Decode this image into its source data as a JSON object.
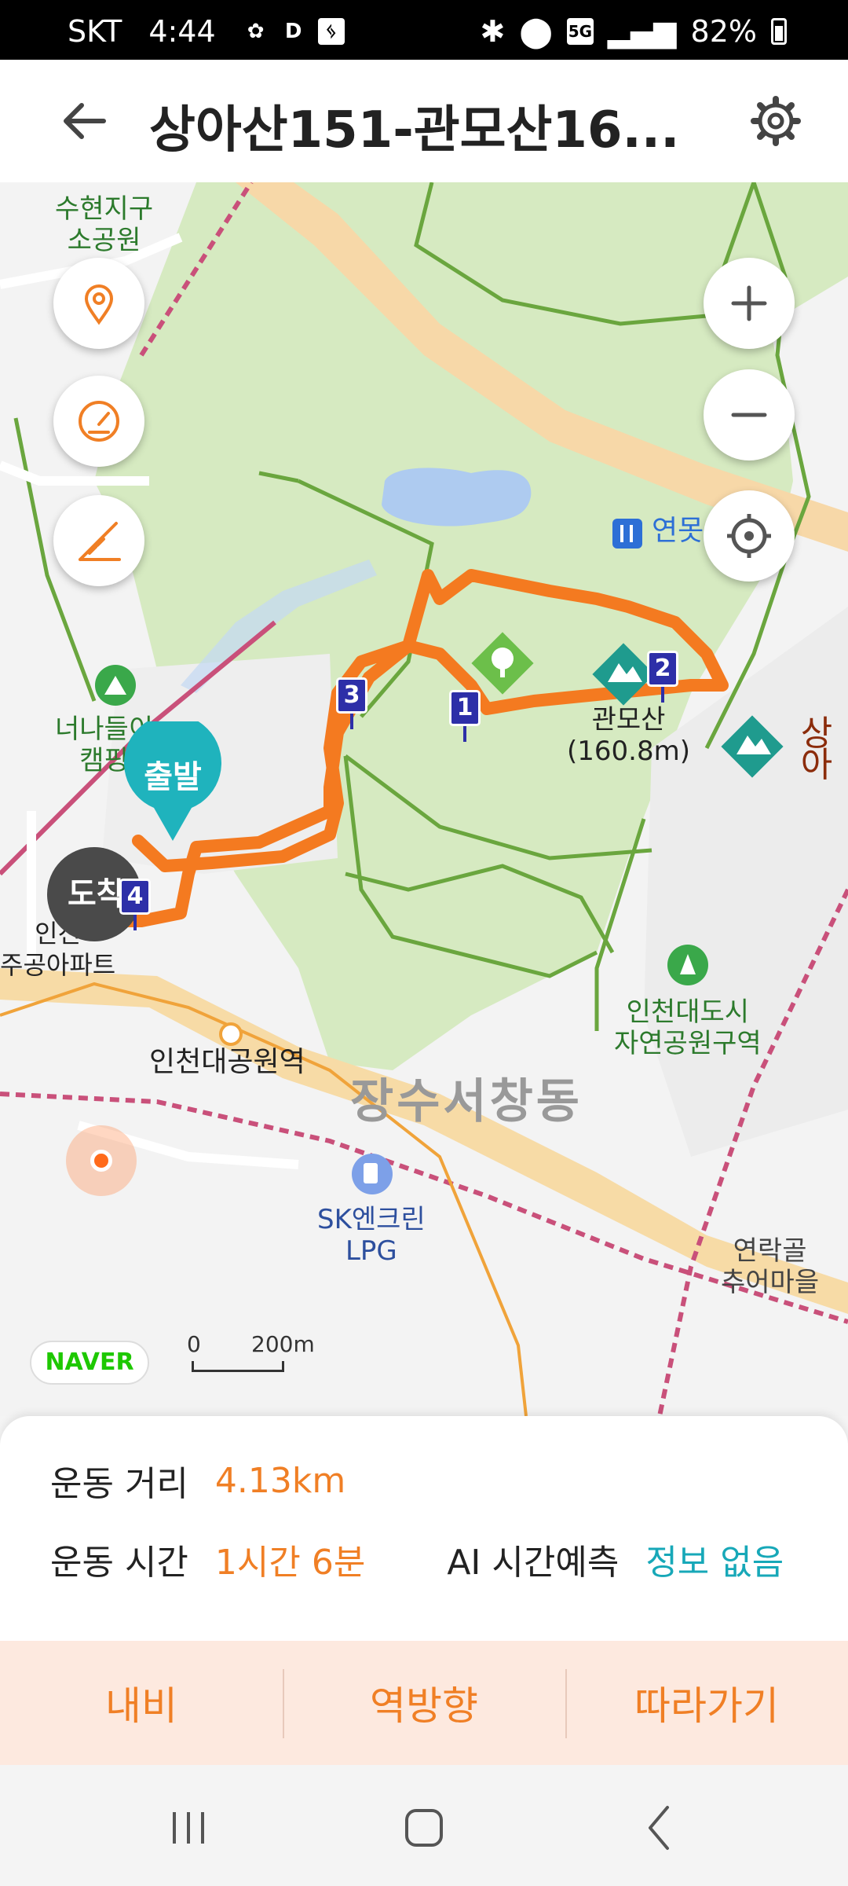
{
  "status_bar": {
    "carrier": "SKT",
    "time": "4:44",
    "network": "5G",
    "battery": "82%"
  },
  "header": {
    "title": "상아산151-관모산16..."
  },
  "map": {
    "labels": {
      "suhyeon": "수현지구\n소공원",
      "yeonmot": "연못",
      "gwanmosan": "관모산\n(160.8m)",
      "sanga": "상아",
      "naneul_camping": "너나들이\n캠핑",
      "incheon_apt": "인천\n주공아파트",
      "station": "인천대공원역",
      "district": "장수서창동",
      "nature_park": "인천대도시\n자연공원구역",
      "sk_lpg": "SK엔크린\nLPG",
      "yeonrakgol": "연락골\n추어마을"
    },
    "markers": {
      "start": "출발",
      "end": "도착",
      "waypoints": [
        "1",
        "2",
        "3",
        "4"
      ]
    },
    "naver_logo": "NAVER",
    "scale": {
      "zero": "0",
      "distance": "200m"
    },
    "colors": {
      "route": "#f47a20",
      "park": "#d8ebc4",
      "water": "#aecbf0",
      "accent": "#f07f25"
    }
  },
  "info": {
    "distance_label": "운동 거리",
    "distance_value": "4.13km",
    "time_label": "운동 시간",
    "time_value": "1시간 6분",
    "ai_label": "AI 시간예측",
    "ai_value": "정보 없음"
  },
  "actions": {
    "navi": "내비",
    "reverse": "역방향",
    "follow": "따라가기"
  }
}
